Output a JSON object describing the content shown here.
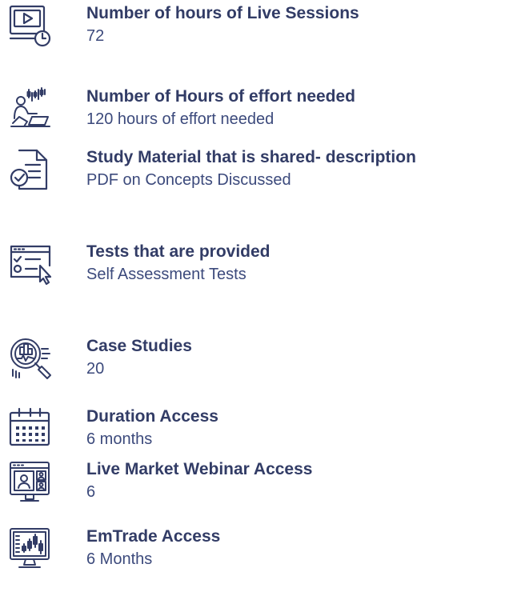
{
  "accent_color": "#323c66",
  "items": [
    {
      "icon": "video-clock-icon",
      "title": "Number of hours of Live Sessions",
      "value": "72"
    },
    {
      "icon": "person-laptop-chart-icon",
      "title": "Number of Hours of effort needed",
      "value": "120 hours of effort needed"
    },
    {
      "icon": "document-check-icon",
      "title": "Study Material that is shared- description",
      "value": "PDF on Concepts Discussed"
    },
    {
      "icon": "test-checklist-cursor-icon",
      "title": "Tests that are provided",
      "value": "Self Assessment Tests"
    },
    {
      "icon": "magnifier-chart-icon",
      "title": "Case Studies",
      "value": "20"
    },
    {
      "icon": "calendar-icon",
      "title": "Duration Access",
      "value": "6 months"
    },
    {
      "icon": "webinar-screen-icon",
      "title": "Live Market Webinar Access",
      "value": "6"
    },
    {
      "icon": "candlestick-monitor-icon",
      "title": "EmTrade Access",
      "value": "6 Months"
    }
  ]
}
